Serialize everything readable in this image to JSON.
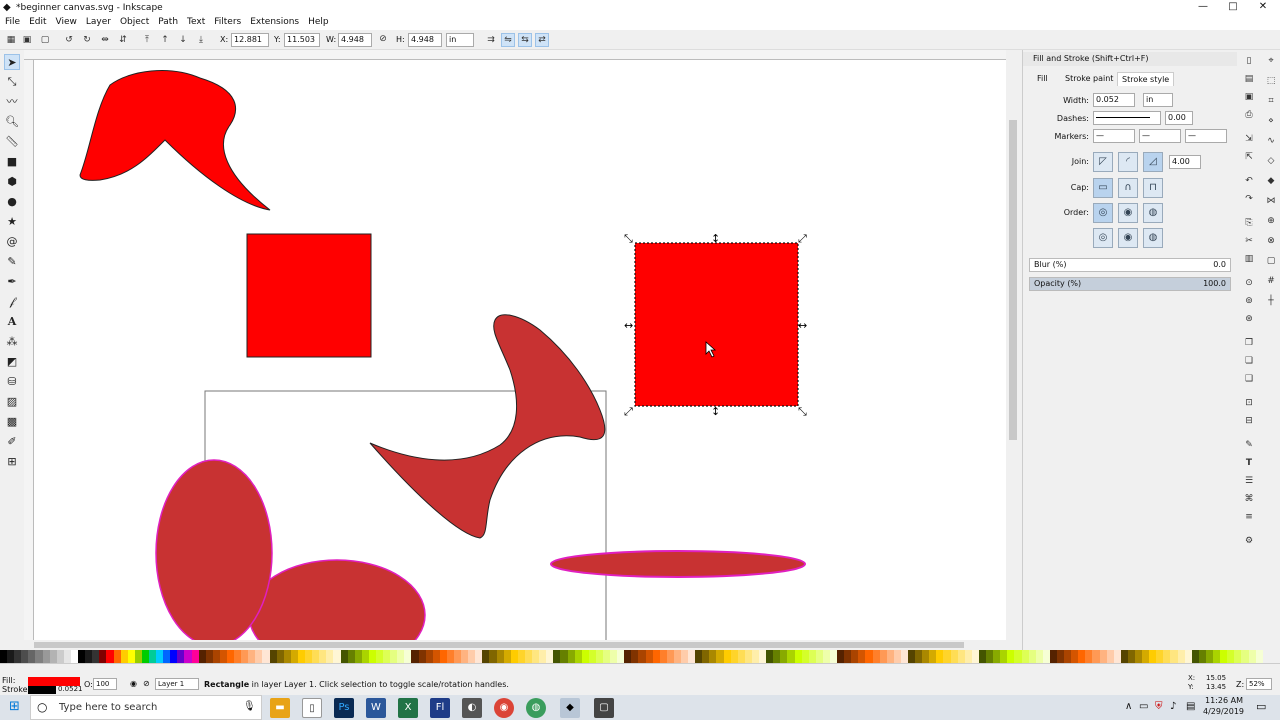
{
  "window": {
    "title": "*beginner canvas.svg - Inkscape",
    "minimize": "—",
    "maximize": "□",
    "close": "✕"
  },
  "menu": [
    "File",
    "Edit",
    "View",
    "Layer",
    "Object",
    "Path",
    "Text",
    "Filters",
    "Extensions",
    "Help"
  ],
  "controls": {
    "x_label": "X:",
    "x": "12.881",
    "y_label": "Y:",
    "y": "11.503",
    "w_label": "W:",
    "w": "4.948",
    "h_label": "H:",
    "h": "4.948",
    "unit": "in"
  },
  "tools": [
    "select-tool",
    "node-tool",
    "tweak-tool",
    "zoom-tool",
    "measure-tool",
    "rect-tool",
    "3dbox-tool",
    "ellipse-tool",
    "star-tool",
    "spiral-tool",
    "pencil-tool",
    "pen-tool",
    "calligraphy-tool",
    "text-tool",
    "spray-tool",
    "eraser-tool",
    "bucket-tool",
    "gradient-tool",
    "mesh-tool",
    "dropper-tool",
    "connector-tool"
  ],
  "panel": {
    "title": "Fill and Stroke (Shift+Ctrl+F)",
    "tabs": [
      "Fill",
      "Stroke paint",
      "Stroke style"
    ],
    "width_label": "Width:",
    "width": "0.052",
    "width_unit": "in",
    "dashes_label": "Dashes:",
    "dash_offset": "0.00",
    "markers_label": "Markers:",
    "join_label": "Join:",
    "miter": "4.00",
    "cap_label": "Cap:",
    "order_label": "Order:",
    "blur_label": "Blur (%)",
    "blur": "0.0",
    "opacity_label": "Opacity (%)",
    "opacity": "100.0"
  },
  "colors": {
    "red": "#ff0000",
    "dark_red": "#c83232",
    "magenta": "#e020c0",
    "selection": "#000000"
  },
  "status": {
    "fill_label": "Fill:",
    "stroke_label": "Stroke:",
    "stroke_width": "0.0521",
    "opacity_label": "O:",
    "opacity": "100",
    "layer": "Layer 1",
    "message_bold": "Rectangle",
    "message": " in layer Layer 1. Click selection to toggle scale/rotation handles.",
    "cursor_x_label": "X:",
    "cursor_x": "15.05",
    "cursor_y_label": "Y:",
    "cursor_y": "13.45",
    "zoom_label": "Z:",
    "zoom": "52%"
  },
  "taskbar": {
    "search_placeholder": "Type here to search",
    "time": "11:26 AM",
    "date": "4/29/2019"
  }
}
